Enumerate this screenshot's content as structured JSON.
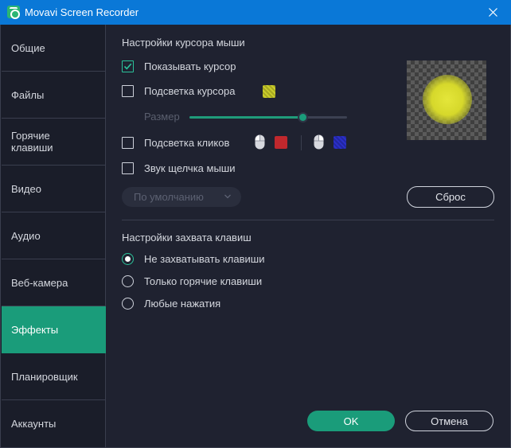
{
  "window": {
    "title": "Movavi Screen Recorder",
    "close_glyph": "✕",
    "app_icon": "movavi-logo-icon"
  },
  "sidebar": {
    "items": [
      {
        "label": "Общие",
        "active": false
      },
      {
        "label": "Файлы",
        "active": false
      },
      {
        "label": "Горячие клавиши",
        "active": false
      },
      {
        "label": "Видео",
        "active": false
      },
      {
        "label": "Аудио",
        "active": false
      },
      {
        "label": "Веб-камера",
        "active": false
      },
      {
        "label": "Эффекты",
        "active": true
      },
      {
        "label": "Планировщик",
        "active": false
      },
      {
        "label": "Аккаунты",
        "active": false
      }
    ]
  },
  "cursor_settings": {
    "title": "Настройки курсора мыши",
    "show_cursor": {
      "label": "Показывать курсор",
      "checked": true
    },
    "highlight_cursor": {
      "label": "Подсветка курсора",
      "checked": false,
      "color": "#c9cc2a"
    },
    "size": {
      "label": "Размер",
      "value_fraction": 0.72,
      "enabled": false
    },
    "highlight_clicks": {
      "label": "Подсветка кликов",
      "checked": false,
      "left_click_color": "#c0282d",
      "right_click_color": "#2a2fc8"
    },
    "click_sound": {
      "label": "Звук щелчка мыши",
      "checked": false
    },
    "sound_dropdown": {
      "value": "По умолчанию",
      "enabled": false
    },
    "reset_button": "Сброс",
    "preview_glow_color": "#dfe135"
  },
  "key_capture": {
    "title": "Настройки захвата клавиш",
    "options": [
      {
        "label": "Не захватывать клавиши",
        "selected": true
      },
      {
        "label": "Только горячие клавиши",
        "selected": false
      },
      {
        "label": "Любые нажатия",
        "selected": false
      }
    ]
  },
  "footer": {
    "ok": "OK",
    "cancel": "Отмена"
  },
  "colors": {
    "accent": "#1a9c7a",
    "titlebar": "#0a78d7",
    "background": "#1f2230"
  }
}
